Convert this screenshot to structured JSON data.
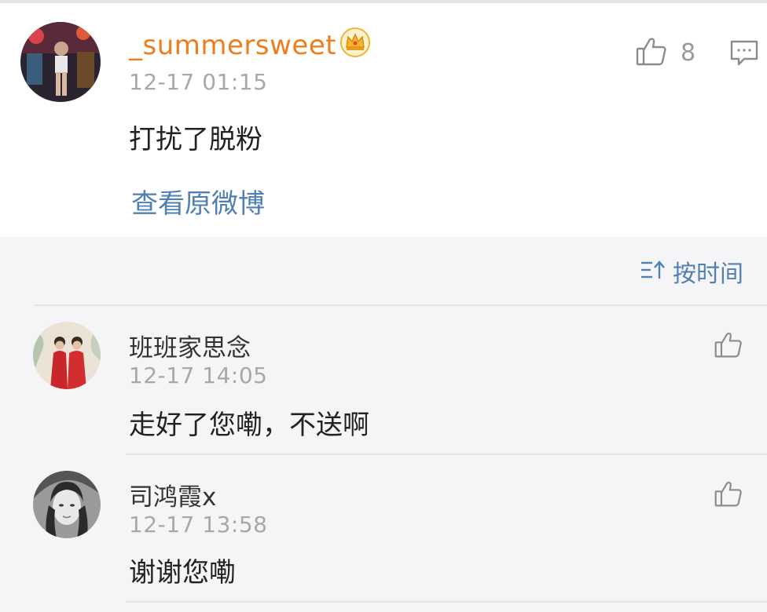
{
  "main_comment": {
    "username": "_summersweet",
    "timestamp": "12-17 01:15",
    "text": "打扰了脱粉",
    "like_count": "8",
    "view_original_label": "查看原微博",
    "icons": {
      "badge": "crown-badge-icon",
      "like": "thumbs-up-icon",
      "reply": "comment-icon"
    },
    "colors": {
      "username": "#f07d1b",
      "link": "#4f7fb3"
    }
  },
  "sort": {
    "label": "按时间",
    "icon": "sort-icon"
  },
  "replies": [
    {
      "username": "班班家思念",
      "timestamp": "12-17 14:05",
      "text": "走好了您嘞，不送啊"
    },
    {
      "username": "司鸿霞x",
      "timestamp": "12-17 13:58",
      "text": "谢谢您嘞"
    }
  ]
}
